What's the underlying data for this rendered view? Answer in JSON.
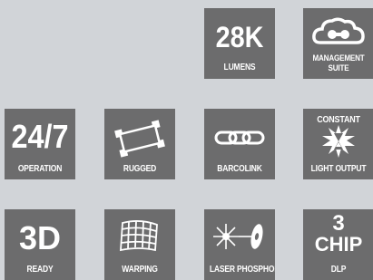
{
  "tiles": {
    "lumens": {
      "big": "28K",
      "caption": "LUMENS"
    },
    "management": {
      "caption_line1": "MANAGEMENT",
      "caption_line2": "SUITE"
    },
    "operation": {
      "big": "24/7",
      "caption": "OPERATION"
    },
    "rugged": {
      "caption": "RUGGED"
    },
    "barcolink": {
      "caption": "BARCOLINK"
    },
    "constant": {
      "top": "CONSTANT",
      "caption": "LIGHT OUTPUT"
    },
    "ready": {
      "big": "3D",
      "caption": "READY"
    },
    "warping": {
      "caption": "WARPING"
    },
    "laser": {
      "caption": "LASER PHOSPHOR"
    },
    "chip": {
      "big1": "3",
      "big2": "CHIP",
      "caption": "DLP"
    }
  },
  "colors": {
    "tile_bg": "#6c6c6d",
    "page_bg": "#d1d4d8",
    "text": "#ffffff"
  },
  "icons": [
    "cloud-binoculars-icon",
    "rugged-frame-icon",
    "chain-link-icon",
    "hourglass-burst-icon",
    "grid-warp-icon",
    "laser-disc-icon"
  ]
}
